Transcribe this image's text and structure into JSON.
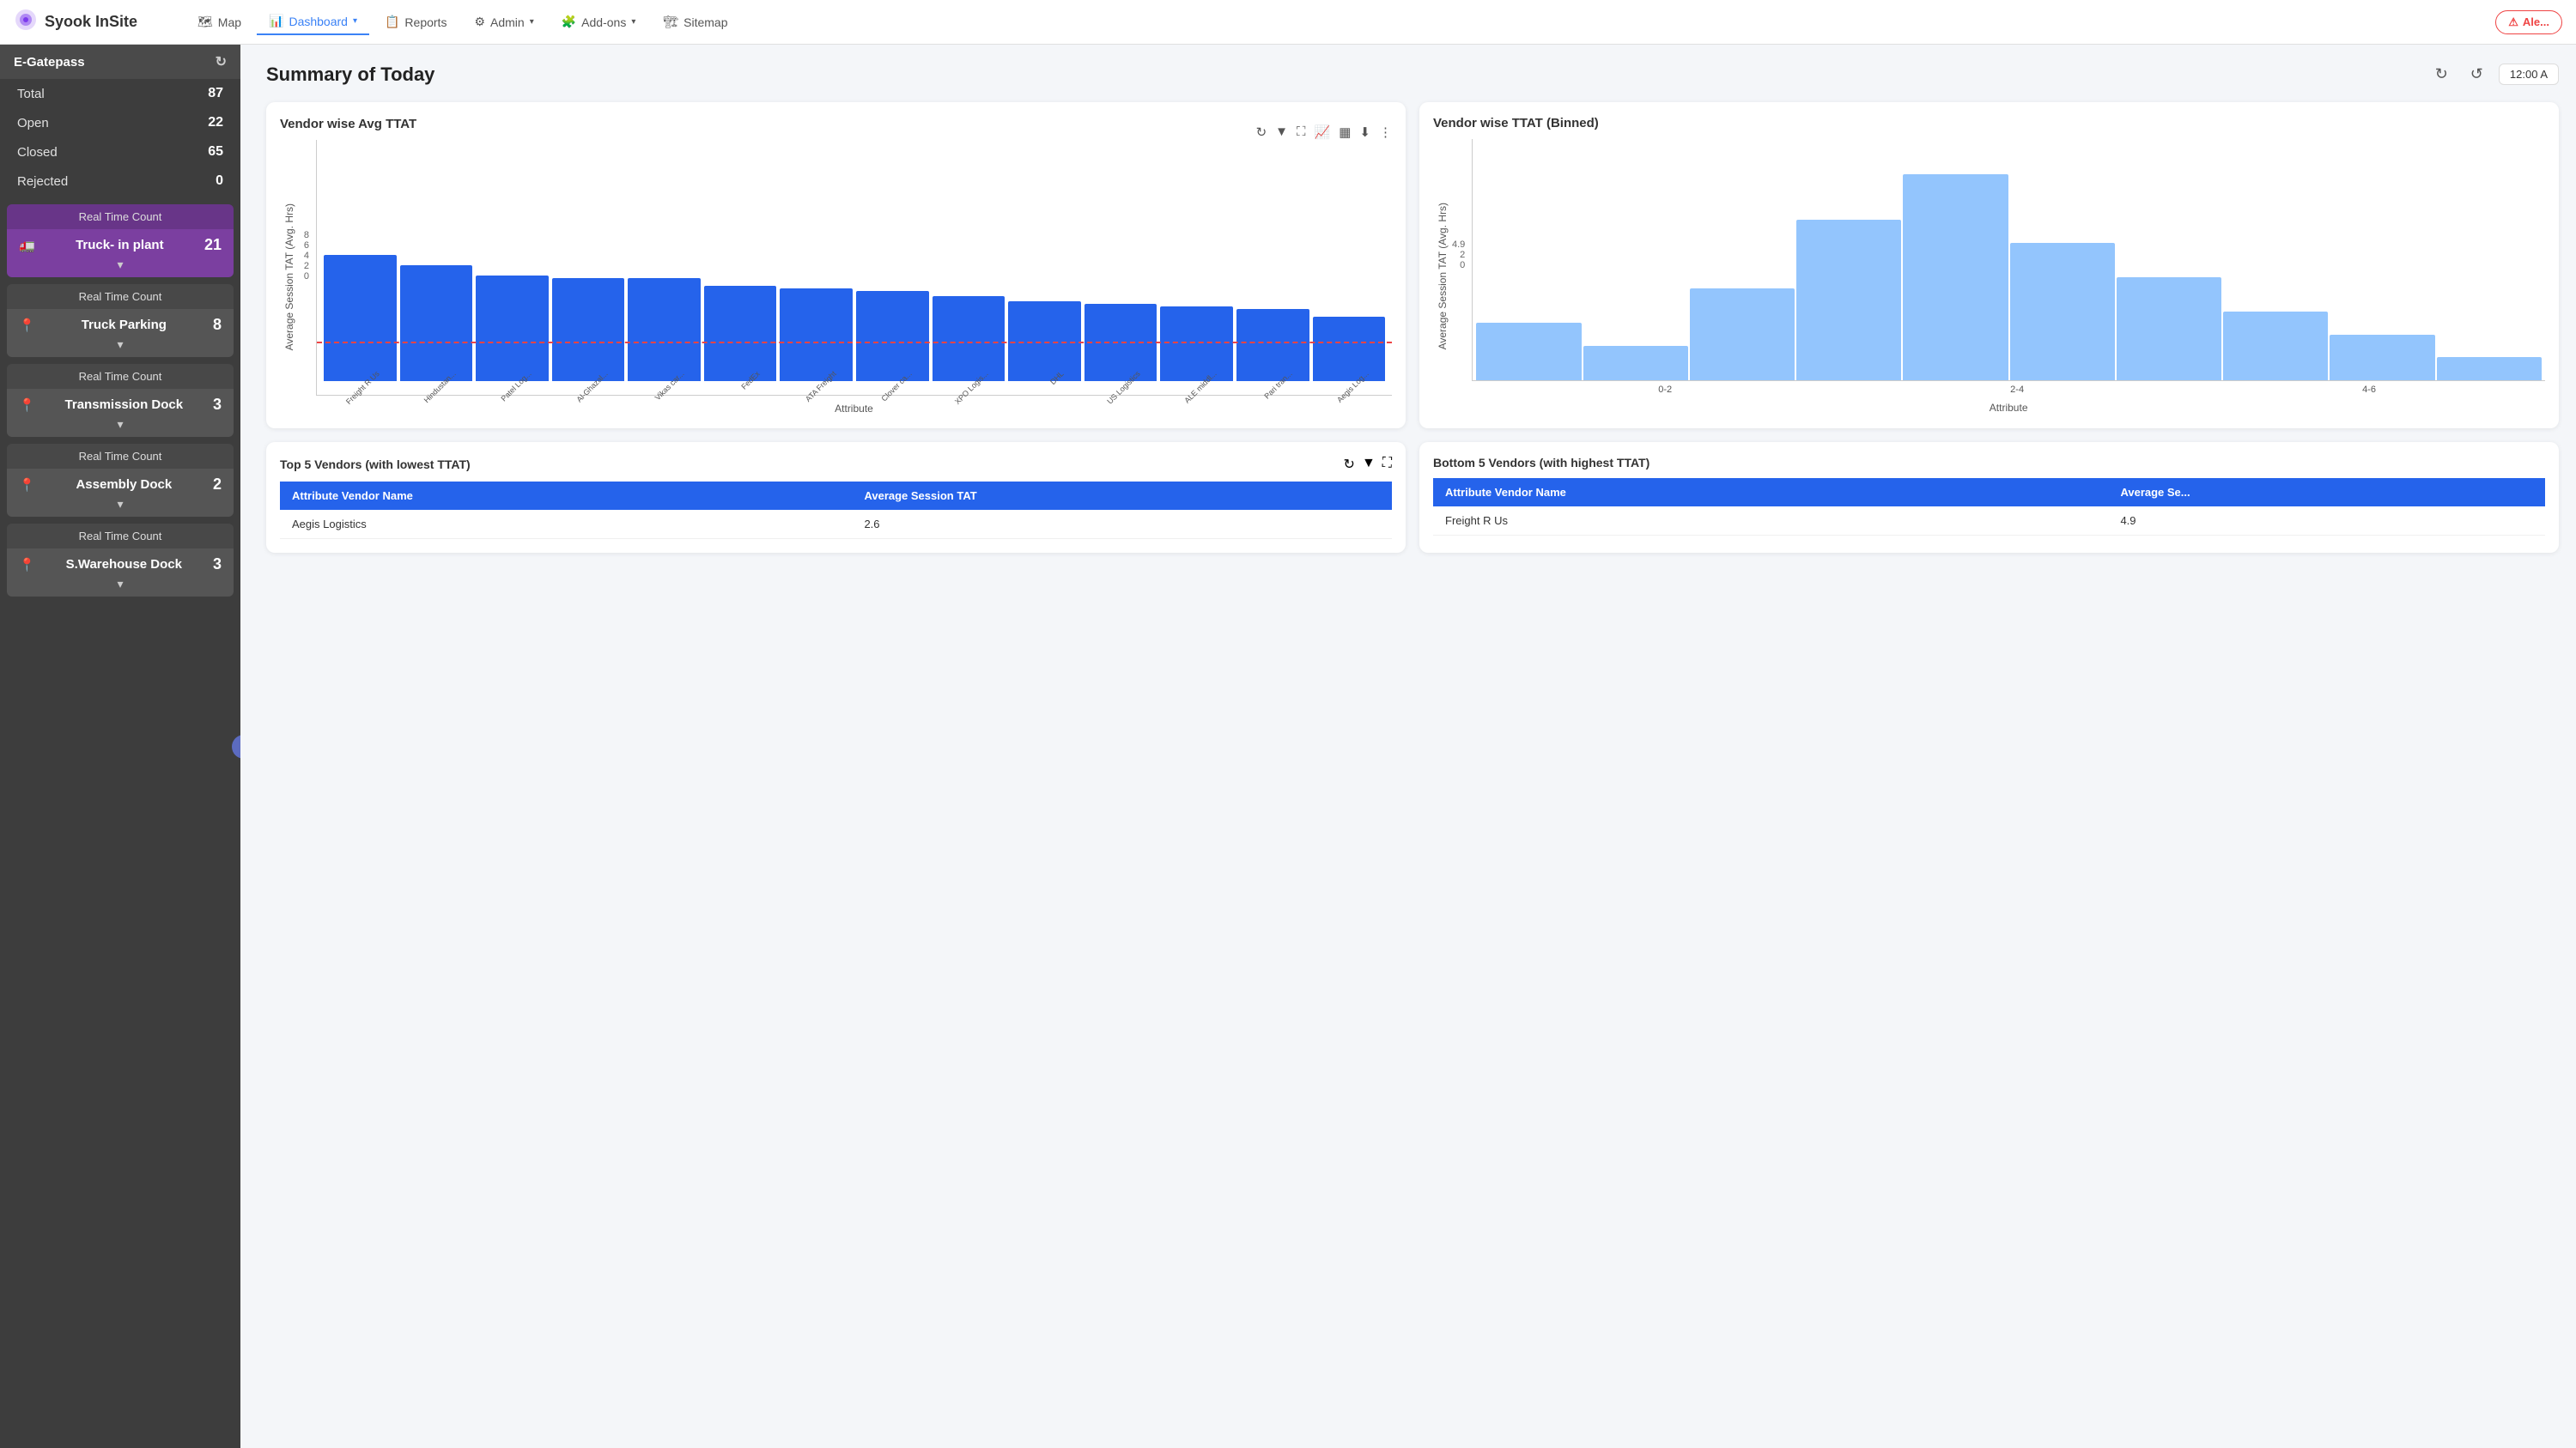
{
  "brand": {
    "name": "Syook InSite",
    "icon": "◎"
  },
  "navbar": {
    "items": [
      {
        "id": "map",
        "label": "Map",
        "icon": "🗺",
        "active": false
      },
      {
        "id": "dashboard",
        "label": "Dashboard",
        "icon": "📊",
        "active": true,
        "has_dropdown": true
      },
      {
        "id": "reports",
        "label": "Reports",
        "icon": "📋",
        "active": false
      },
      {
        "id": "admin",
        "label": "Admin",
        "icon": "⚙",
        "active": false,
        "has_dropdown": true
      },
      {
        "id": "addons",
        "label": "Add-ons",
        "icon": "🧩",
        "active": false,
        "has_dropdown": true
      },
      {
        "id": "sitemap",
        "label": "Sitemap",
        "icon": "🏗",
        "active": false
      }
    ],
    "alert_btn": "Ale..."
  },
  "sidebar": {
    "header": "E-Gatepass",
    "stats": [
      {
        "label": "Total",
        "value": "87"
      },
      {
        "label": "Open",
        "value": "22"
      },
      {
        "label": "Closed",
        "value": "65"
      },
      {
        "label": "Rejected",
        "value": "0"
      }
    ],
    "rtc_cards": [
      {
        "id": "truck-plant",
        "label": "Real Time Count",
        "name": "Truck- in plant",
        "icon": "🚛",
        "count": "21",
        "active": true
      },
      {
        "id": "truck-parking",
        "label": "Real Time Count",
        "name": "Truck Parking",
        "icon": "📍",
        "count": "8",
        "active": false
      },
      {
        "id": "transmission-dock",
        "label": "Real Time Count",
        "name": "Transmission Dock",
        "icon": "📍",
        "count": "3",
        "active": false
      },
      {
        "id": "assembly-dock",
        "label": "Real Time Count",
        "name": "Assembly Dock",
        "icon": "📍",
        "count": "2",
        "active": false
      },
      {
        "id": "swarehouse-dock",
        "label": "Real Time Count",
        "name": "S.Warehouse Dock",
        "icon": "📍",
        "count": "3",
        "active": false
      }
    ]
  },
  "main": {
    "title": "Summary of Today",
    "time": "12:00 A",
    "vendor_avg_ttat": {
      "title": "Vendor wise Avg TTAT",
      "y_axis_label": "Average Session TAT (Avg. Hrs)",
      "x_axis_label": "Attribute",
      "y_ticks": [
        "8",
        "6",
        "4",
        "2",
        "0"
      ],
      "red_line_value": 2,
      "bars": [
        {
          "label": "Freight R Us",
          "value": 4.9
        },
        {
          "label": "Hindustan...",
          "value": 4.5
        },
        {
          "label": "Patel Log...",
          "value": 4.1
        },
        {
          "label": "Al-Ghazal...",
          "value": 4.0
        },
        {
          "label": "Vikas car...",
          "value": 4.0
        },
        {
          "label": "FedEx",
          "value": 3.7
        },
        {
          "label": "ATA Freight",
          "value": 3.6
        },
        {
          "label": "Clover ca...",
          "value": 3.5
        },
        {
          "label": "XPO Logis...",
          "value": 3.3
        },
        {
          "label": "DHL",
          "value": 3.1
        },
        {
          "label": "US Logistics",
          "value": 3.0
        },
        {
          "label": "ALE middl...",
          "value": 2.9
        },
        {
          "label": "Pari tran...",
          "value": 2.8
        },
        {
          "label": "Aegis Log...",
          "value": 2.5
        }
      ],
      "max_value": 8
    },
    "vendor_ttat_binned": {
      "title": "Vendor wise TTAT (Binned)",
      "y_axis_label": "Average Session TAT (Avg. Hrs)",
      "x_axis_label": "Attribute",
      "y_ticks": [
        "4.9",
        "2",
        "0"
      ],
      "x_ticks": [
        "0-2",
        "2-4",
        "4-6"
      ],
      "bins": [
        {
          "label": "0-2",
          "value": 5
        },
        {
          "label": "",
          "value": 3
        },
        {
          "label": "",
          "value": 8
        },
        {
          "label": "",
          "value": 14
        },
        {
          "label": "2-4",
          "value": 18
        },
        {
          "label": "",
          "value": 12
        },
        {
          "label": "",
          "value": 9
        },
        {
          "label": "",
          "value": 6
        },
        {
          "label": "4-6",
          "value": 4
        },
        {
          "label": "",
          "value": 2
        }
      ]
    },
    "top5_vendors": {
      "title": "Top 5 Vendors (with lowest TTAT)",
      "columns": [
        "Attribute Vendor Name",
        "Average Session TAT"
      ],
      "rows": [
        {
          "vendor": "Aegis Logistics",
          "tat": "2.6"
        }
      ]
    },
    "bottom5_vendors": {
      "title": "Bottom 5 Vendors (with highest TTAT)",
      "columns": [
        "Attribute Vendor Name",
        "Average Se..."
      ],
      "rows": [
        {
          "vendor": "Freight R Us",
          "tat": "4.9"
        }
      ]
    }
  }
}
